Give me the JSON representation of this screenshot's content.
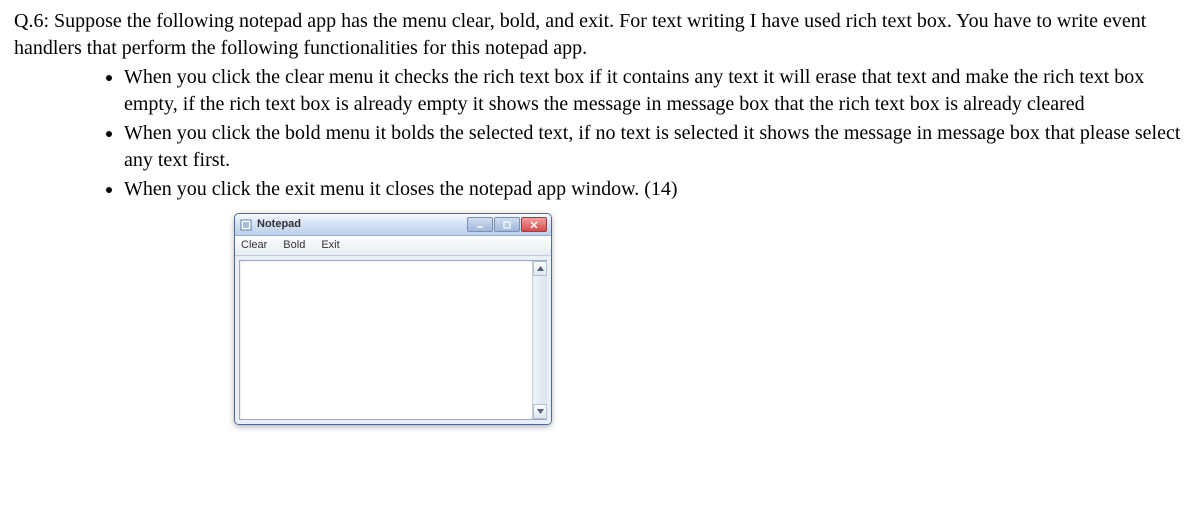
{
  "question": {
    "heading": "Q.6: Suppose the following notepad app has the menu clear, bold, and exit. For text writing I have used rich text box. You have to write event handlers that perform the following functionalities for this notepad app.",
    "bullets": [
      "When you click the clear menu it checks the rich text box if it contains any text it will erase that text and make the rich text box empty, if the rich text box is already empty it shows the message in message box that the rich text box is already cleared",
      "When you click the bold menu it bolds the selected text, if no text is selected it shows the message in message box that please select any text first.",
      "When you click the exit menu it closes the notepad app window.  (14)"
    ]
  },
  "app": {
    "title": "Notepad",
    "menu": {
      "clear": "Clear",
      "bold": "Bold",
      "exit": "Exit"
    },
    "text_value": ""
  }
}
